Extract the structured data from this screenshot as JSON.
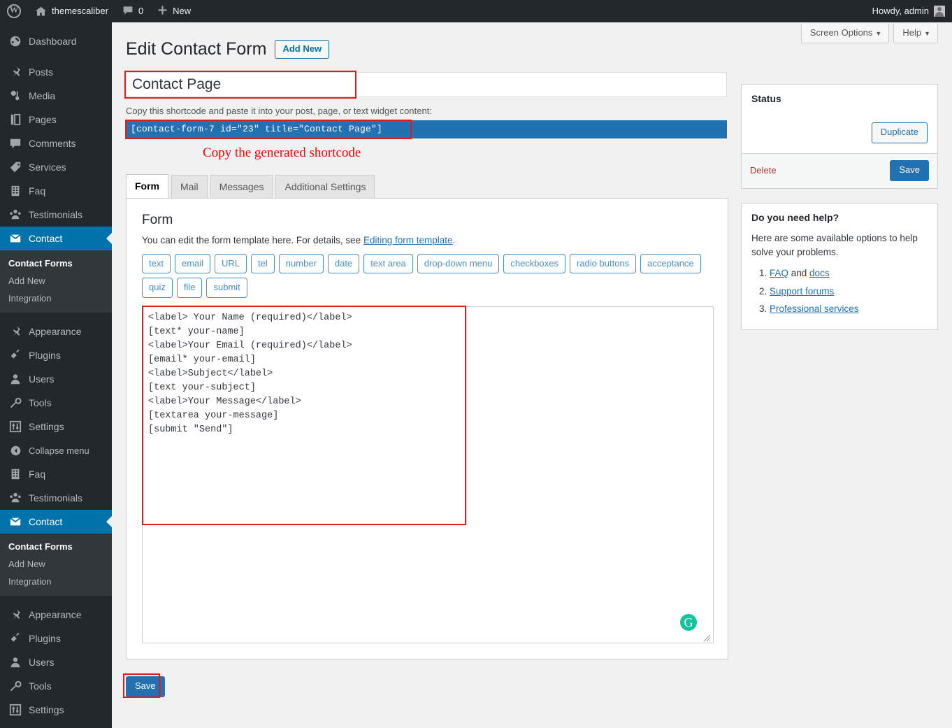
{
  "adminbar": {
    "site_name": "themescaliber",
    "comment_count": "0",
    "new_label": "New",
    "howdy": "Howdy, admin",
    "wp_logo_icon": "wordpress-logo-icon",
    "home_icon": "home-icon",
    "comment_icon": "comment-bubble-icon",
    "plus_icon": "plus-icon",
    "avatar_icon": "avatar-icon"
  },
  "screen_meta": {
    "screen_options": "Screen Options",
    "help": "Help",
    "caret": "▼"
  },
  "sidebar": {
    "items": [
      {
        "label": "Dashboard",
        "icon": "dashboard-icon"
      },
      {
        "label": "Posts",
        "icon": "pin-icon"
      },
      {
        "label": "Media",
        "icon": "media-icon"
      },
      {
        "label": "Pages",
        "icon": "pages-icon"
      },
      {
        "label": "Comments",
        "icon": "comment-bubble-icon"
      },
      {
        "label": "Services",
        "icon": "tag-icon"
      },
      {
        "label": "Faq",
        "icon": "document-icon"
      },
      {
        "label": "Testimonials",
        "icon": "users-group-icon"
      },
      {
        "label": "Contact",
        "icon": "envelope-icon",
        "current": true
      },
      {
        "label": "Appearance",
        "icon": "paintbrush-icon"
      },
      {
        "label": "Plugins",
        "icon": "plug-icon"
      },
      {
        "label": "Users",
        "icon": "user-icon"
      },
      {
        "label": "Tools",
        "icon": "wrench-icon"
      },
      {
        "label": "Settings",
        "icon": "sliders-icon"
      },
      {
        "label": "Collapse menu",
        "icon": "collapse-arrow-icon"
      },
      {
        "label": "Faq",
        "icon": "document-icon"
      },
      {
        "label": "Testimonials",
        "icon": "users-group-icon"
      },
      {
        "label": "Contact",
        "icon": "envelope-icon",
        "current": true
      },
      {
        "label": "Appearance",
        "icon": "paintbrush-icon"
      },
      {
        "label": "Plugins",
        "icon": "plug-icon"
      },
      {
        "label": "Users",
        "icon": "user-icon"
      },
      {
        "label": "Tools",
        "icon": "wrench-icon"
      },
      {
        "label": "Settings",
        "icon": "sliders-icon"
      }
    ],
    "submenu": {
      "heading": "Contact Forms",
      "items": [
        "Add New",
        "Integration"
      ]
    }
  },
  "page": {
    "title": "Edit Contact Form",
    "add_new_label": "Add New",
    "form_title_value": "Contact Page",
    "shortcode_hint": "Copy this shortcode and paste it into your post, page, or text widget content:",
    "shortcode_value": "[contact-form-7 id=\"23\" title=\"Contact Page\"]",
    "annotation": "Copy  the generated shortcode"
  },
  "tabs": [
    {
      "label": "Form",
      "active": true
    },
    {
      "label": "Mail",
      "active": false
    },
    {
      "label": "Messages",
      "active": false
    },
    {
      "label": "Additional Settings",
      "active": false
    }
  ],
  "form_panel": {
    "heading": "Form",
    "description_pre": "You can edit the form template here. For details, see ",
    "description_link": "Editing form template",
    "description_post": ".",
    "tag_buttons": [
      "text",
      "email",
      "URL",
      "tel",
      "number",
      "date",
      "text area",
      "drop-down menu",
      "checkboxes",
      "radio buttons",
      "acceptance",
      "quiz",
      "file",
      "submit"
    ],
    "template_value": "<label> Your Name (required)</label>\n[text* your-name]\n<label>Your Email (required)</label>\n[email* your-email]\n<label>Subject</label>\n[text your-subject]\n<label>Your Message</label>\n[textarea your-message]\n[submit \"Send\"]",
    "grammarly_glyph": "G"
  },
  "bottom": {
    "save_label": "Save"
  },
  "status_box": {
    "heading": "Status",
    "duplicate_label": "Duplicate",
    "delete_label": "Delete",
    "save_label": "Save"
  },
  "help_box": {
    "heading": "Do you need help?",
    "body": "Here are some available options to help solve your problems.",
    "items": [
      {
        "pre": "",
        "link": "FAQ",
        "mid": " and ",
        "link2": "docs"
      },
      {
        "pre": "",
        "link": "Support forums",
        "mid": "",
        "link2": ""
      },
      {
        "pre": "",
        "link": "Professional services",
        "mid": "",
        "link2": ""
      }
    ]
  },
  "colors": {
    "admin_dark": "#23282d",
    "submenu_dark": "#32373c",
    "accent_blue": "#0073aa",
    "primary_blue": "#2271b1",
    "highlight_red": "#e01b1b",
    "annotation_red": "#ff0000",
    "grammarly_green": "#15c39a",
    "delete_red": "#b32d2e"
  }
}
